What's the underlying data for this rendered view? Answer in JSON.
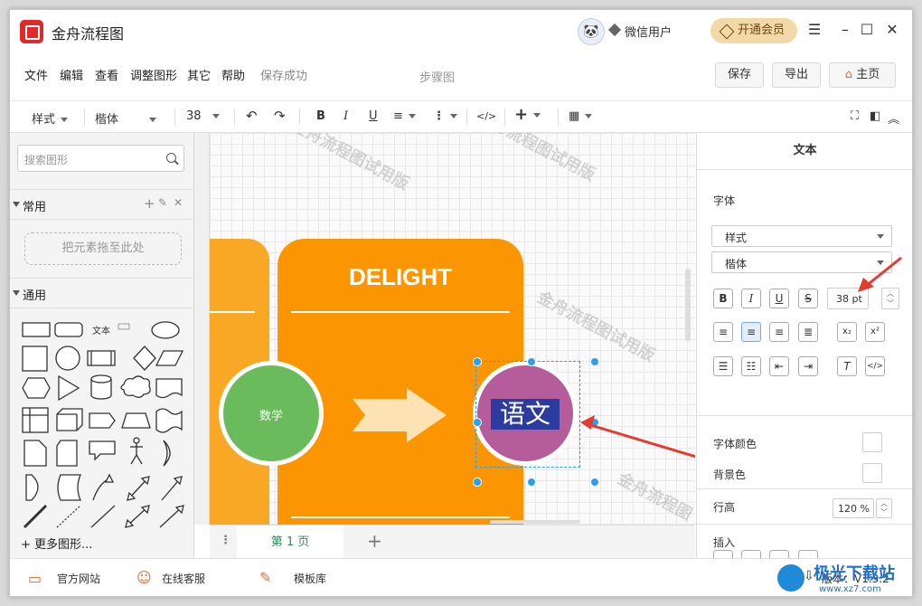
{
  "app": {
    "title": "金舟流程图",
    "user": "微信用户",
    "vip_label": "开通会员"
  },
  "menu": {
    "items": [
      "文件",
      "编辑",
      "查看",
      "调整图形",
      "其它",
      "帮助"
    ],
    "status": "保存成功",
    "doc_title": "步骤图",
    "save_label": "保存",
    "export_label": "导出",
    "home_label": "主页"
  },
  "toolbar": {
    "style_label": "样式",
    "font_family": "楷体",
    "font_size": "38",
    "code_label": "</>"
  },
  "sidebar": {
    "search_placeholder": "搜索图形",
    "common_label": "常用",
    "drop_hint": "把元素拖至此处",
    "general_label": "通用",
    "text_shape": "文本",
    "more_shapes": "更多图形..."
  },
  "canvas": {
    "header_text": "DELIGHT",
    "circle_left_text": "数学",
    "circle_right_text": "语文",
    "watermark": "金舟流程图试用版",
    "watermark_short": "金舟流程图",
    "colors": {
      "left_block": "#f9a825",
      "right_block": "#fb9602",
      "circle_green": "#6abb5b",
      "circle_purple": "#b55d9b"
    }
  },
  "pages": {
    "current": "第 1 页"
  },
  "panel": {
    "tab": "文本",
    "font_section": "字体",
    "style_select": "样式",
    "font_select": "楷体",
    "size_value": "38 pt",
    "font_color_label": "字体颜色",
    "bg_color_label": "背景色",
    "line_height_label": "行高",
    "line_height_value": "120 %",
    "insert_label": "插入"
  },
  "footer": {
    "website": "官方网站",
    "service": "在线客服",
    "templates": "模板库",
    "version": "版本：V1.3.2"
  },
  "overlay": {
    "brand": "极光下载站",
    "url": "www.xz7.com"
  }
}
